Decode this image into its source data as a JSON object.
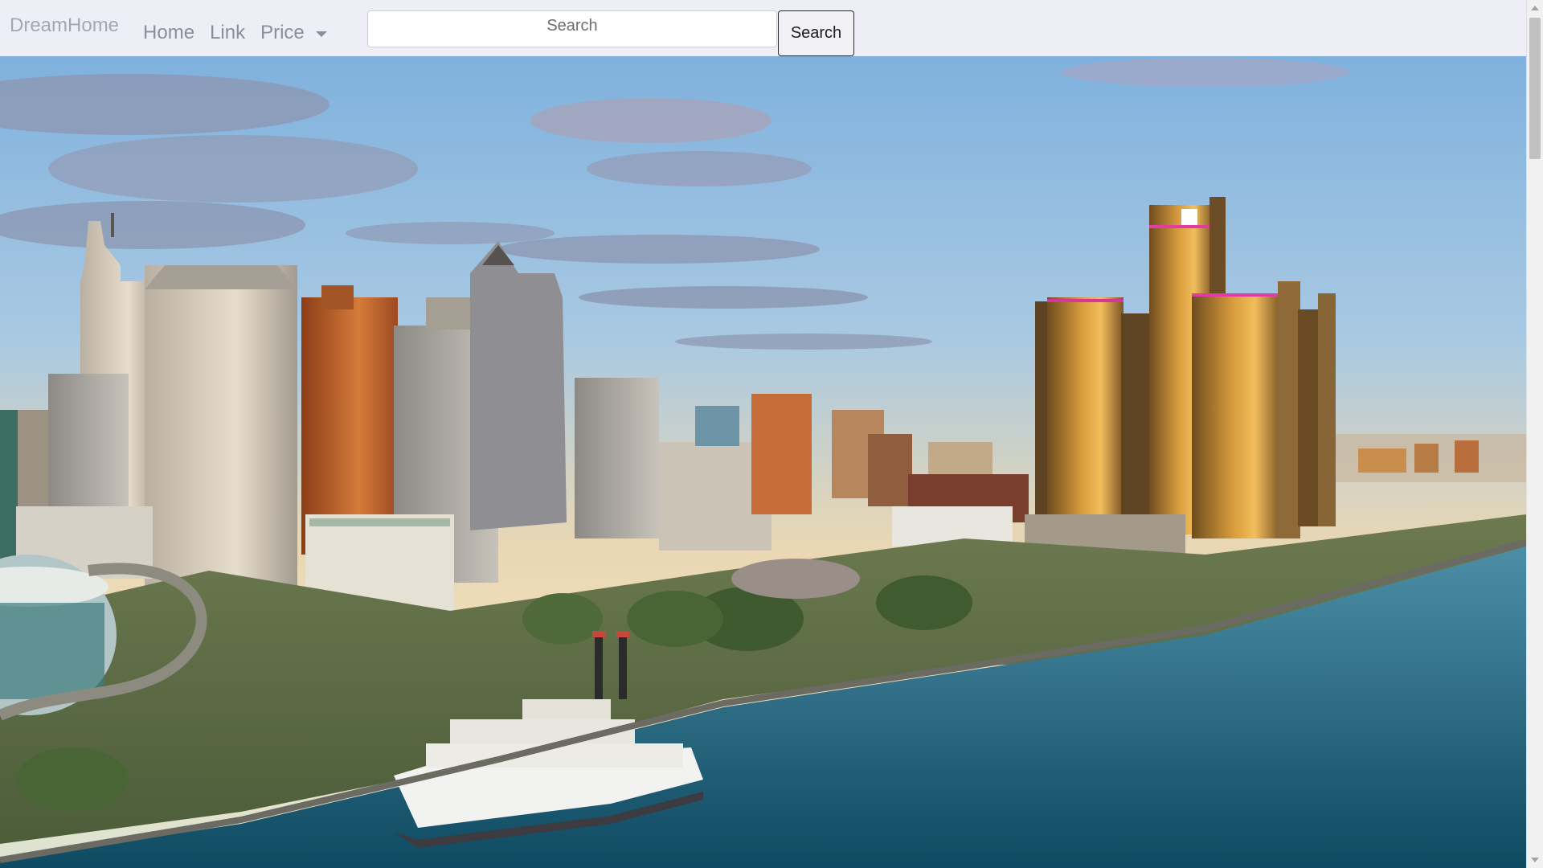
{
  "navbar": {
    "brand": "DreamHome",
    "links": [
      {
        "label": "Home"
      },
      {
        "label": "Link"
      },
      {
        "label": "Price"
      }
    ],
    "search": {
      "placeholder": "Search",
      "button_label": "Search"
    }
  },
  "hero": {
    "icon": "city-skyline-photo"
  },
  "colors": {
    "navbar_bg": "#eeeef6",
    "brand_text": "#a6a6b2",
    "link_text": "#8d8d9a"
  }
}
